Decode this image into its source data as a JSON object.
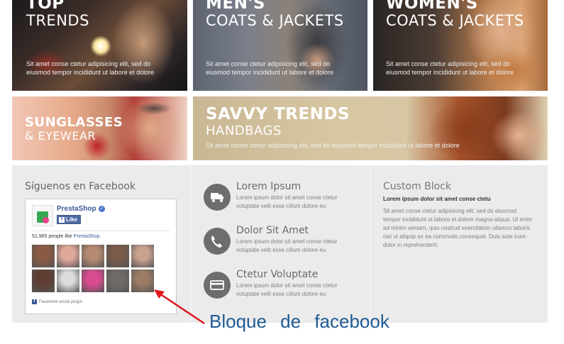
{
  "banners": [
    {
      "line1": "TOP",
      "line2": "TRENDS",
      "description": "Sit amet conse ctetur adipisicing elit, sed do eiusmod tempor incididunt ut labore et dolore"
    },
    {
      "line1": "MEN'S",
      "line2": "COATS & JACKETS",
      "description": "Sit amet conse ctetur adipisicing elit, sed do eiusmod tempor incididunt ut labore et dolore"
    },
    {
      "line1": "WOMEN'S",
      "line2": "COATS & JACKETS",
      "description": "Sit amet conse ctetur adipisicing elit, sed do eiusmod tempor incididunt ut labore et dolore"
    },
    {
      "line1": "SUNGLASSES",
      "line2": "& EYEWEAR",
      "description": ""
    },
    {
      "line1": "SAVVY TRENDS",
      "line2": "HANDBAGS",
      "description": "Sit amet conse ctetur adipisicing elit, sed do eiusmod tempor incididunt ut labore et dolore"
    }
  ],
  "facebook": {
    "title": "Síguenos en Facebook",
    "page_name": "PrestaShop",
    "like_label": "Like",
    "likes_count": "51,965 people like",
    "likes_link": "PrestaShop.",
    "plugin_label": "Facebook social plugin",
    "faces": [
      "#8a5a44",
      "#e0a899",
      "#b58a72",
      "#7a5a48",
      "#c9a18e",
      "#5e3d33",
      "#dcdcdc",
      "#d94b8f",
      "#6f6a66",
      "#9a7b64"
    ]
  },
  "services": [
    {
      "icon": "truck-icon",
      "title": "Lorem Ipsum",
      "text": "Lorem ipsum dolor sit amet conse ctetur voluptate velit esse cillum dolore eu"
    },
    {
      "icon": "phone-icon",
      "title": "Dolor Sit Amet",
      "text": "Lorem ipsum dolor sit amet conse ctetur voluptate velit esse cillum dolore eu"
    },
    {
      "icon": "credit-card-icon",
      "title": "Ctetur Voluptate",
      "text": "Lorem ipsum dolor sit amet conse ctetur voluptate velit esse cillum dolore eu"
    }
  ],
  "custom_block": {
    "title": "Custom Block",
    "subtitle": "Lorem ipsum dolor sit amet conse ctetu",
    "text": "Sit amet conse ctetur adipisicing elit, sed do eiusmod tempor incididunt ut labore et dolore magna aliqua. Ut enim ad minim veniam, quis nostrud exercitation ullamco laboris nisi ut aliquip ex ea commodo consequat. Duis aute irure dolor in reprehenderit."
  },
  "annotation": {
    "text": "Bloque de facebook",
    "color": "#1f5b95",
    "arrow_color": "#e0161b"
  }
}
